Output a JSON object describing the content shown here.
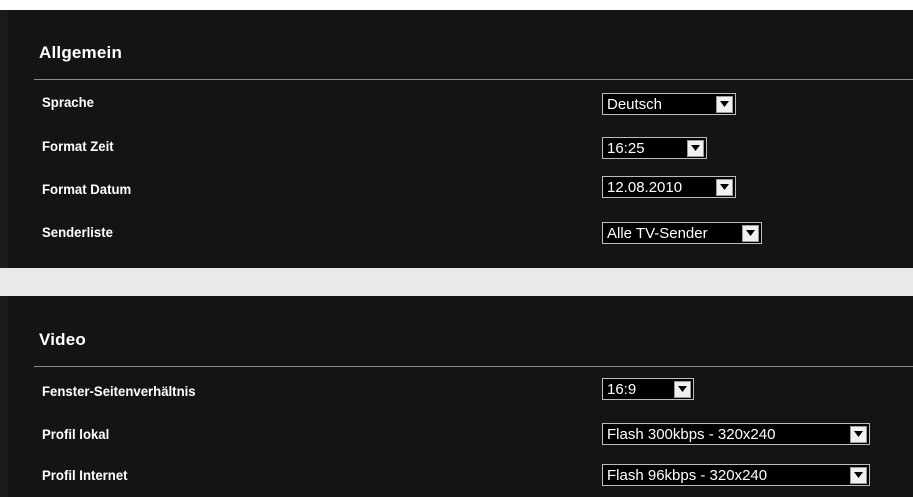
{
  "sections": [
    {
      "title": "Allgemein",
      "rows": [
        {
          "label": "Sprache",
          "value": "Deutsch"
        },
        {
          "label": "Format Zeit",
          "value": "16:25"
        },
        {
          "label": "Format Datum",
          "value": "12.08.2010"
        },
        {
          "label": "Senderliste",
          "value": "Alle TV-Sender"
        }
      ]
    },
    {
      "title": "Video",
      "rows": [
        {
          "label": "Fenster-Seitenverhältnis",
          "value": "16:9"
        },
        {
          "label": "Profil lokal",
          "value": "Flash 300kbps - 320x240"
        },
        {
          "label": "Profil Internet",
          "value": "Flash 96kbps - 320x240"
        }
      ]
    }
  ],
  "icons": {
    "dropdown": "chevron-down-icon"
  },
  "colors": {
    "background": "#141414",
    "text": "#ffffff",
    "separator_band": "#e9e9e9",
    "divider": "#8a8a8a"
  }
}
